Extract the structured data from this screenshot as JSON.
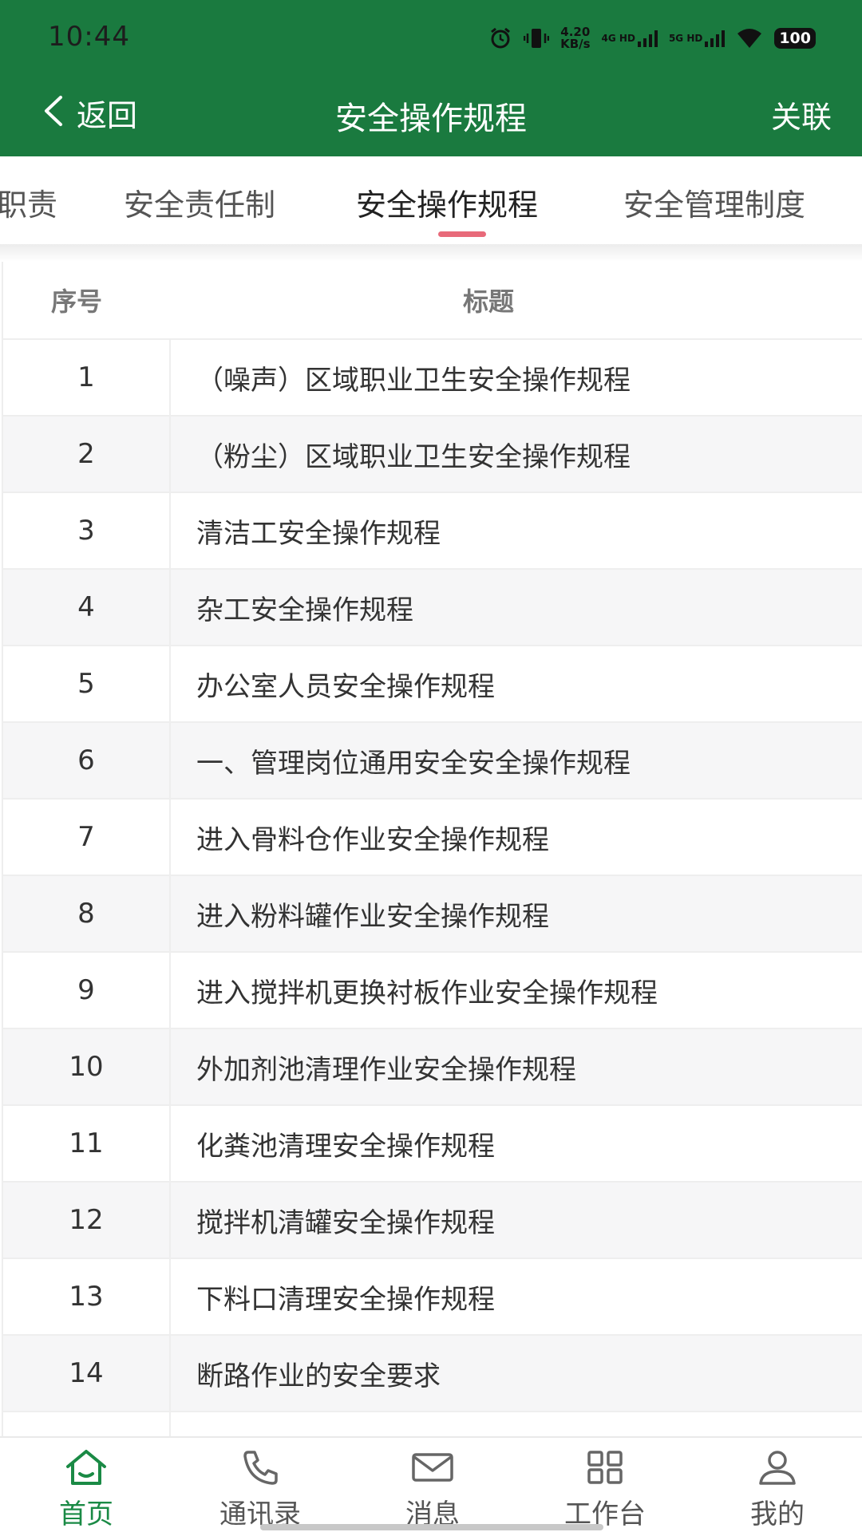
{
  "status_bar": {
    "time": "10:44",
    "net_speed_value": "4.20",
    "net_speed_unit": "KB/s",
    "sim1_label": "4G HD",
    "sim2_label": "5G HD",
    "battery": "100",
    "icons": [
      "alarm-icon",
      "vibrate-icon",
      "signal-4g-icon",
      "signal-5g-icon",
      "wifi-icon",
      "battery-icon"
    ]
  },
  "header": {
    "back_label": "返回",
    "title": "安全操作规程",
    "action_label": "关联",
    "background_color": "#1a7a3f"
  },
  "tabs": {
    "items": [
      {
        "label": "职责"
      },
      {
        "label": "安全责任制"
      },
      {
        "label": "安全操作规程"
      },
      {
        "label": "安全管理制度"
      }
    ],
    "active_index": 2,
    "indicator_color": "#e86a7a"
  },
  "table": {
    "headers": {
      "no": "序号",
      "title": "标题"
    },
    "rows": [
      {
        "no": "1",
        "title": "（噪声）区域职业卫生安全操作规程"
      },
      {
        "no": "2",
        "title": "（粉尘）区域职业卫生安全操作规程"
      },
      {
        "no": "3",
        "title": "清洁工安全操作规程"
      },
      {
        "no": "4",
        "title": "杂工安全操作规程"
      },
      {
        "no": "5",
        "title": "办公室人员安全操作规程"
      },
      {
        "no": "6",
        "title": "一、管理岗位通用安全安全操作规程"
      },
      {
        "no": "7",
        "title": "进入骨料仓作业安全操作规程"
      },
      {
        "no": "8",
        "title": "进入粉料罐作业安全操作规程"
      },
      {
        "no": "9",
        "title": "进入搅拌机更换衬板作业安全操作规程"
      },
      {
        "no": "10",
        "title": "外加剂池清理作业安全操作规程"
      },
      {
        "no": "11",
        "title": "化粪池清理安全操作规程"
      },
      {
        "no": "12",
        "title": "搅拌机清罐安全操作规程"
      },
      {
        "no": "13",
        "title": "下料口清理安全操作规程"
      },
      {
        "no": "14",
        "title": "断路作业的安全要求"
      }
    ]
  },
  "bottom_nav": {
    "items": [
      {
        "label": "首页",
        "icon": "home-icon"
      },
      {
        "label": "通讯录",
        "icon": "phone-icon"
      },
      {
        "label": "消息",
        "icon": "mail-icon"
      },
      {
        "label": "工作台",
        "icon": "grid-icon"
      },
      {
        "label": "我的",
        "icon": "user-icon"
      }
    ],
    "active_index": 0,
    "active_color": "#1a8a45"
  }
}
